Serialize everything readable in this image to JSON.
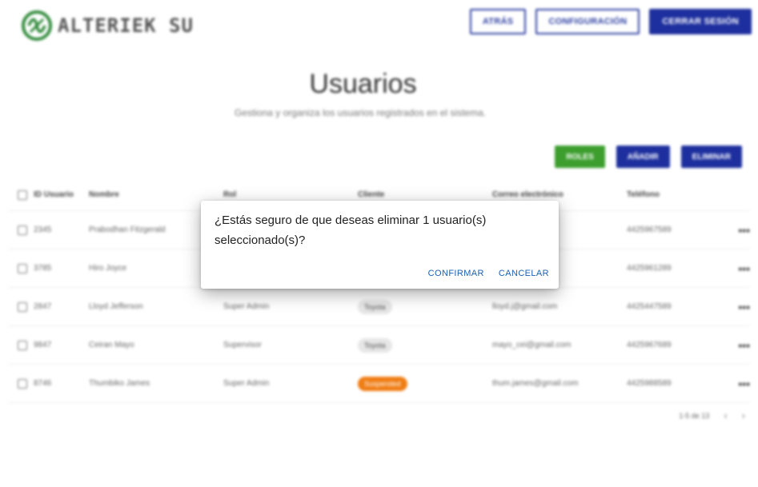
{
  "brand": {
    "name": "ALTERIEK SU",
    "logo_color": "#2f8a3a"
  },
  "header": {
    "back_label": "ATRÁS",
    "settings_label": "CONFIGURACIÓN",
    "logout_label": "CERRAR SESIÓN"
  },
  "main": {
    "title": "Usuarios",
    "subtitle": "Gestiona y organiza los usuarios registrados en el sistema."
  },
  "actions": {
    "roles_label": "ROLES",
    "add_label": "AÑADIR",
    "delete_label": "ELIMINAR"
  },
  "table": {
    "columns": [
      "ID Usuario",
      "Nombre",
      "Rol",
      "Cliente",
      "Correo electrónico",
      "Teléfono"
    ],
    "rows": [
      {
        "id": "2345",
        "name": "Prabodhan Fitzgerald",
        "role": "",
        "client": "",
        "email": "",
        "phone": "4425967589"
      },
      {
        "id": "3785",
        "name": "Hiro Joyce",
        "role": "",
        "client": "",
        "email": "",
        "phone": "4425961289"
      },
      {
        "id": "2847",
        "name": "Lloyd Jefferson",
        "role": "Super Admin",
        "client": "Toyota",
        "email": "lloyd.j@gmail.com",
        "phone": "4425447589"
      },
      {
        "id": "9847",
        "name": "Ceiran Mayo",
        "role": "Supervisor",
        "client": "Toyota",
        "email": "mayo_cei@gmail.com",
        "phone": "4425967689"
      },
      {
        "id": "8746",
        "name": "Thumbiko James",
        "role": "Super Admin",
        "client": "Suspended",
        "email": "thum.james@gmail.com",
        "phone": "4425988589"
      }
    ],
    "more_label": "•••"
  },
  "pagination": {
    "range": "1-5 de 13",
    "prev": "‹",
    "next": "›"
  },
  "dialog": {
    "message": "¿Estás seguro de que deseas eliminar 1 usuario(s) seleccionado(s)?",
    "confirm_label": "CONFIRMAR",
    "cancel_label": "CANCELAR"
  },
  "colors": {
    "primary": "#1d2f9e",
    "success": "#3d9e2e",
    "warning": "#f07d14",
    "link": "#1b5fb3"
  }
}
